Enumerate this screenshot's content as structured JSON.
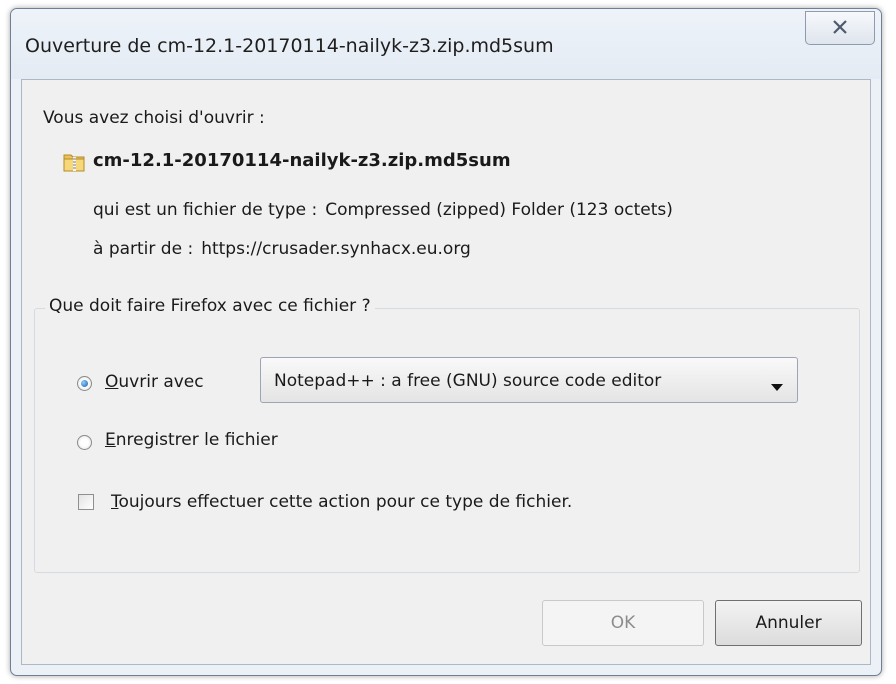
{
  "window": {
    "title": "Ouverture de cm-12.1-20170114-nailyk-z3.zip.md5sum"
  },
  "dialog": {
    "chosen_label": "Vous avez choisi d'ouvrir :",
    "file_name": "cm-12.1-20170114-nailyk-z3.zip.md5sum",
    "file_icon": "zip-folder-icon",
    "type_label": "qui est un fichier de type :",
    "type_value": "Compressed (zipped) Folder (123 octets)",
    "from_label": "à partir de :",
    "from_value": "https://crusader.synhacx.eu.org"
  },
  "action_group": {
    "legend": "Que doit faire Firefox avec ce fichier ?",
    "open_with": {
      "mnemonic": "O",
      "rest": "uvrir avec",
      "checked": true
    },
    "app_select": {
      "value": "Notepad++ : a free (GNU) source code editor"
    },
    "save_file": {
      "mnemonic": "E",
      "rest": "nregistrer le fichier",
      "checked": false
    },
    "always": {
      "mnemonic": "T",
      "rest": "oujours effectuer cette action pour ce type de fichier.",
      "checked": false
    }
  },
  "buttons": {
    "ok": "OK",
    "cancel": "Annuler"
  },
  "colors": {
    "window_frame": "#ecf1f7",
    "client_bg": "#f0f0f0",
    "radio_selected": "#1c5aa8",
    "disabled_text": "#8d8d8d"
  }
}
